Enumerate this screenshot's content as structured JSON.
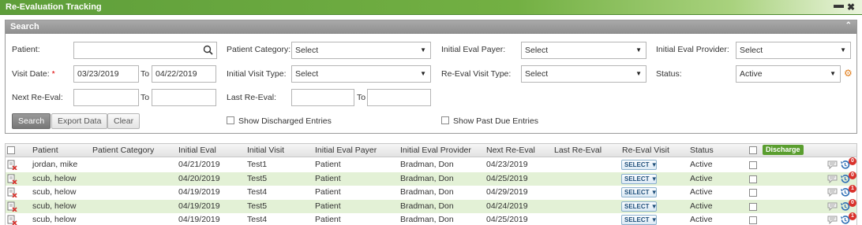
{
  "window": {
    "title": "Re-Evaluation Tracking",
    "minimize": "▬",
    "close": "✖"
  },
  "search": {
    "header": "Search",
    "collapse_icon": "chevron-up-icon",
    "patient_label": "Patient:",
    "patient_value": "",
    "patient_category_label": "Patient Category:",
    "patient_category_value": "Select",
    "initial_eval_payer_label": "Initial Eval Payer:",
    "initial_eval_payer_value": "Select",
    "initial_eval_provider_label": "Initial Eval Provider:",
    "initial_eval_provider_value": "Select",
    "visit_date_label": "Visit Date:",
    "visit_date_required": "*",
    "visit_date_from": "03/23/2019",
    "to_label": "To",
    "visit_date_to": "04/22/2019",
    "initial_visit_type_label": "Initial Visit Type:",
    "initial_visit_type_value": "Select",
    "reeval_visit_type_label": "Re-Eval Visit Type:",
    "reeval_visit_type_value": "Select",
    "status_label": "Status:",
    "status_value": "Active",
    "next_reeval_label": "Next Re-Eval:",
    "next_reeval_from": "",
    "next_reeval_to": "",
    "last_reeval_label": "Last Re-Eval:",
    "last_reeval_from": "",
    "last_reeval_to": "",
    "search_button": "Search",
    "export_button": "Export Data",
    "clear_button": "Clear",
    "show_discharged_label": "Show Discharged Entries",
    "show_discharged_checked": false,
    "show_past_due_label": "Show Past Due Entries",
    "show_past_due_checked": false
  },
  "grid": {
    "columns": [
      "Patient",
      "Patient Category",
      "Initial Eval",
      "Initial Visit",
      "Initial Eval Payer",
      "Initial Eval Provider",
      "Next Re-Eval",
      "Last Re-Eval",
      "Re-Eval Visit",
      "Status"
    ],
    "discharge_button": "Discharge",
    "rows": [
      {
        "patient": "jordan, mike",
        "category": "",
        "initial_eval": "04/21/2019",
        "initial_visit": "Test1",
        "payer": "Patient",
        "provider": "Bradman, Don",
        "next_reeval": "04/23/2019",
        "last_reeval": "",
        "reeval_visit": "SELECT",
        "status": "Active",
        "badge": "0"
      },
      {
        "patient": "scub, helow",
        "category": "",
        "initial_eval": "04/20/2019",
        "initial_visit": "Test5",
        "payer": "Patient",
        "provider": "Bradman, Don",
        "next_reeval": "04/25/2019",
        "last_reeval": "",
        "reeval_visit": "SELECT",
        "status": "Active",
        "badge": "0"
      },
      {
        "patient": "scub, helow",
        "category": "",
        "initial_eval": "04/19/2019",
        "initial_visit": "Test4",
        "payer": "Patient",
        "provider": "Bradman, Don",
        "next_reeval": "04/29/2019",
        "last_reeval": "",
        "reeval_visit": "SELECT",
        "status": "Active",
        "badge": "1"
      },
      {
        "patient": "scub, helow",
        "category": "",
        "initial_eval": "04/19/2019",
        "initial_visit": "Test5",
        "payer": "Patient",
        "provider": "Bradman, Don",
        "next_reeval": "04/24/2019",
        "last_reeval": "",
        "reeval_visit": "SELECT",
        "status": "Active",
        "badge": "0"
      },
      {
        "patient": "scub, helow",
        "category": "",
        "initial_eval": "04/19/2019",
        "initial_visit": "Test4",
        "payer": "Patient",
        "provider": "Bradman, Don",
        "next_reeval": "04/25/2019",
        "last_reeval": "",
        "reeval_visit": "SELECT",
        "status": "Active",
        "badge": "1"
      }
    ]
  },
  "colors": {
    "title_green": "#5e9e3a",
    "row_alt": "#e3f1d6",
    "badge_red": "#d9312b",
    "discharge_green": "#5a9e2f"
  }
}
